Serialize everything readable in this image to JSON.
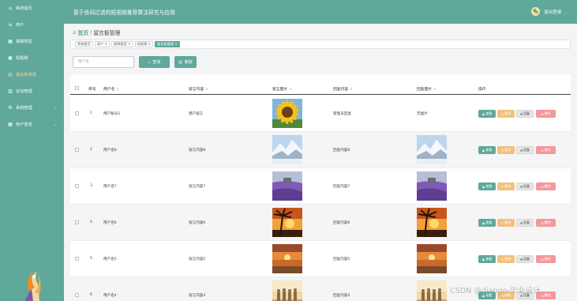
{
  "app": {
    "title": "基于协同过滤的短视频推荐算法研究与应用",
    "logout": "退出登录"
  },
  "sidebar": {
    "items": [
      {
        "label": "系统首页",
        "icon": "home-icon",
        "glyph": "⌂",
        "expand": false
      },
      {
        "label": "用户",
        "icon": "list-icon",
        "glyph": "≡",
        "expand": false
      },
      {
        "label": "视频类型",
        "icon": "category-icon",
        "glyph": "▦",
        "expand": false
      },
      {
        "label": "短视频",
        "icon": "video-icon",
        "glyph": "▣",
        "expand": false
      },
      {
        "label": "留言板管理",
        "icon": "message-icon",
        "glyph": "▤",
        "expand": false,
        "active": true
      },
      {
        "label": "论坛管理",
        "icon": "forum-icon",
        "glyph": "▥",
        "expand": false
      },
      {
        "label": "系统管理",
        "icon": "settings-icon",
        "glyph": "⚙",
        "expand": true
      },
      {
        "label": "用户信息",
        "icon": "user-info-icon",
        "glyph": "▦",
        "expand": true
      }
    ]
  },
  "breadcrumb": {
    "home": "首页",
    "sep": "/",
    "current": "留言板管理"
  },
  "tags": [
    {
      "label": "系统首页",
      "close": ""
    },
    {
      "label": "用户",
      "close": " ×"
    },
    {
      "label": "视频类型",
      "close": " ×"
    },
    {
      "label": "短视频",
      "close": " ×"
    },
    {
      "label": "留言板管理",
      "close": " ×",
      "active": true
    }
  ],
  "search": {
    "placeholder": "用户名",
    "button": "查询",
    "delete": "删除"
  },
  "table": {
    "headers": {
      "index": "序号",
      "username": "用户名",
      "content": "留言内容",
      "image": "留言图片",
      "reply": "回复内容",
      "reply_image": "回复图片",
      "actions": "操作"
    },
    "actions": {
      "view": "查看",
      "edit": "修改",
      "reply": "回复",
      "delete": "删除"
    },
    "rows": [
      {
        "index": "1",
        "username": "用户账号1",
        "content": "用户留言",
        "image": "sunflower",
        "reply": "管理员回复",
        "reply_image_text": "无图片",
        "reply_image": ""
      },
      {
        "index": "2",
        "username": "用户名8",
        "content": "留言内容8",
        "image": "snow-mountain",
        "reply": "回复内容8",
        "reply_image_text": "",
        "reply_image": "snow-mountain"
      },
      {
        "index": "3",
        "username": "用户名7",
        "content": "留言内容7",
        "image": "lavender",
        "reply": "回复内容7",
        "reply_image_text": "",
        "reply_image": "lavender"
      },
      {
        "index": "4",
        "username": "用户名6",
        "content": "留言内容6",
        "image": "palm-sunset",
        "reply": "回复内容6",
        "reply_image_text": "",
        "reply_image": "palm-sunset"
      },
      {
        "index": "5",
        "username": "用户名5",
        "content": "留言内容5",
        "image": "beach-sunset",
        "reply": "回复内容5",
        "reply_image_text": "",
        "reply_image": "beach-sunset"
      },
      {
        "index": "6",
        "username": "用户名4",
        "content": "留言内容4",
        "image": "people-sunset",
        "reply": "回复内容4",
        "reply_image_text": "",
        "reply_image": "people-sunset"
      }
    ]
  },
  "watermark": "CSDN @django-毕业设计",
  "colors": {
    "primary": "#5fa89a",
    "edit": "#f2c07d",
    "delete": "#f3989b",
    "active_menu": "#f3d39a"
  }
}
